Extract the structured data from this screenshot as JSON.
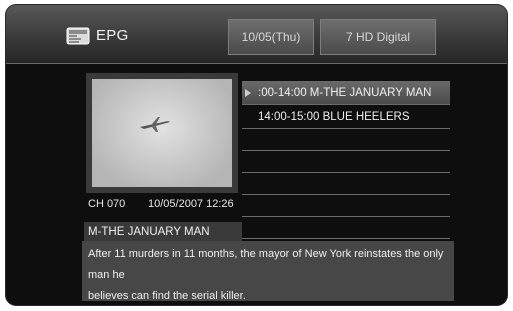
{
  "header": {
    "title": "EPG",
    "date_button": "10/05(Thu)",
    "channel_button": "7 HD Digital",
    "icon": "tv-guide-icon"
  },
  "preview": {
    "channel": "CH 070",
    "datetime": "10/05/2007 12:26",
    "icon": "airplane-thumbnail"
  },
  "programs": [
    {
      "label": ":00-14:00 M-THE JANUARY MAN",
      "selected": true
    },
    {
      "label": "14:00-15:00 BLUE HEELERS",
      "selected": false
    },
    {
      "label": "",
      "selected": false
    },
    {
      "label": "",
      "selected": false
    },
    {
      "label": "",
      "selected": false
    },
    {
      "label": "",
      "selected": false
    },
    {
      "label": "",
      "selected": false
    }
  ],
  "details": {
    "title": "M-THE JANUARY MAN",
    "description_line1": "After 11 murders in 11 months, the mayor of New York reinstates the only man he",
    "description_line2": "believes can find the serial killer."
  }
}
